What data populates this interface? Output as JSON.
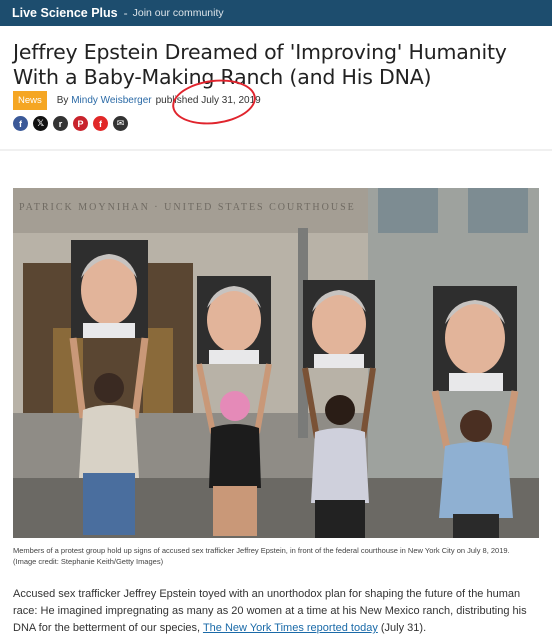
{
  "topbar": {
    "brand": "Live Science Plus",
    "separator": "-",
    "join": "Join our community"
  },
  "article": {
    "title": "Jeffrey Epstein Dreamed of 'Improving' Humanity With a Baby-Making Ranch (and His DNA)",
    "category": "News",
    "by": "By",
    "author": "Mindy Weisberger",
    "published_label": "published",
    "date": "July 31, 2019"
  },
  "share": [
    {
      "icon": "facebook-icon",
      "glyph": "f",
      "color": "#3b5998"
    },
    {
      "icon": "x-twitter-icon",
      "glyph": "𝕏",
      "color": "#111111"
    },
    {
      "icon": "reddit-icon",
      "glyph": "r",
      "color": "#333333"
    },
    {
      "icon": "pinterest-icon",
      "glyph": "P",
      "color": "#c8232c"
    },
    {
      "icon": "flipboard-icon",
      "glyph": "f",
      "color": "#e12828"
    },
    {
      "icon": "email-icon",
      "glyph": "✉",
      "color": "#333333"
    }
  ],
  "photo": {
    "building_sign": "PATRICK MOYNIHAN · UNITED STATES COURTHOUSE",
    "caption": "Members of a protest group hold up signs of accused sex trafficker Jeffrey Epstein, in front of the federal courthouse in New York City on July 8, 2019.",
    "credit": "(Image credit: Stephanie Keith/Getty Images)"
  },
  "body": {
    "text_before": "Accused sex trafficker Jeffrey Epstein toyed with an unorthodox plan for shaping the future of the human race: He imagined impregnating as many as 20 women at a time at his New Mexico ranch, distributing his DNA for the betterment of our species, ",
    "link": "The New York Times reported today",
    "text_after": " (July 31)."
  },
  "colors": {
    "topbar": "#1d4d6e",
    "badge": "#f5a623",
    "link": "#2b6aa6",
    "annotation_circle": "#e0242d"
  }
}
